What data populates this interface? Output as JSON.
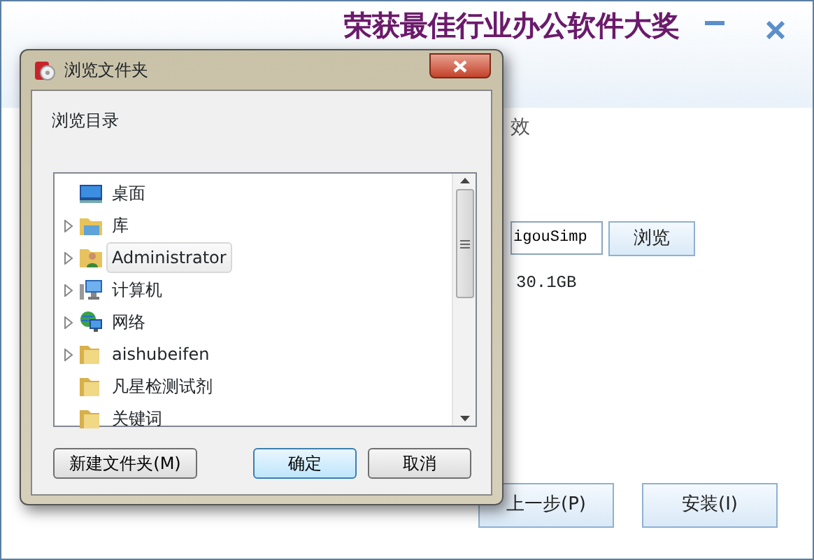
{
  "app": {
    "slogan": "荣获最佳行业办公软件大奖",
    "subtitle_fragment": "效",
    "path_value": "igouSimp",
    "browse_button": "浏览",
    "space_text": "30.1GB",
    "back_button": "上一步(P)",
    "install_button": "安装(I)"
  },
  "dialog": {
    "title": "浏览文件夹",
    "prompt": "浏览目录",
    "tree": [
      {
        "label": "桌面",
        "kind": "desktop",
        "expandable": false,
        "selected": false
      },
      {
        "label": "库",
        "kind": "library",
        "expandable": true,
        "selected": false
      },
      {
        "label": "Administrator",
        "kind": "user",
        "expandable": true,
        "selected": true
      },
      {
        "label": "计算机",
        "kind": "computer",
        "expandable": true,
        "selected": false
      },
      {
        "label": "网络",
        "kind": "network",
        "expandable": true,
        "selected": false
      },
      {
        "label": "aishubeifen",
        "kind": "folder",
        "expandable": true,
        "selected": false
      },
      {
        "label": "凡星检测试剂",
        "kind": "folder",
        "expandable": false,
        "selected": false
      },
      {
        "label": "关键词",
        "kind": "folder",
        "expandable": false,
        "selected": false
      }
    ],
    "new_folder_button": "新建文件夹(M)",
    "ok_button": "确定",
    "cancel_button": "取消"
  }
}
